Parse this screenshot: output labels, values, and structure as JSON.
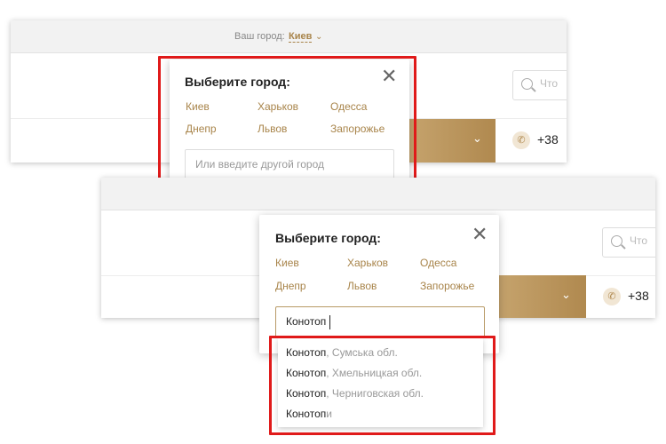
{
  "header": {
    "city_label": "Ваш город:",
    "current_city": "Киев"
  },
  "search": {
    "placeholder": "Что"
  },
  "phone": {
    "number": "+38"
  },
  "popup": {
    "title": "Выберите город:",
    "cities": [
      "Киев",
      "Харьков",
      "Одесса",
      "Днепр",
      "Львов",
      "Запорожье"
    ],
    "input_placeholder": "Или введите другой город",
    "input_value": "Конотоп"
  },
  "suggestions": [
    {
      "name": "Конотоп",
      "region": ", Сумська обл."
    },
    {
      "name": "Конотоп",
      "region": ", Хмельницкая обл."
    },
    {
      "name": "Конотоп",
      "region": ", Черниговская обл."
    },
    {
      "name": "Конотоп",
      "region": "и"
    }
  ],
  "colors": {
    "accent": "#a8844a",
    "highlight": "#e01a1a"
  }
}
